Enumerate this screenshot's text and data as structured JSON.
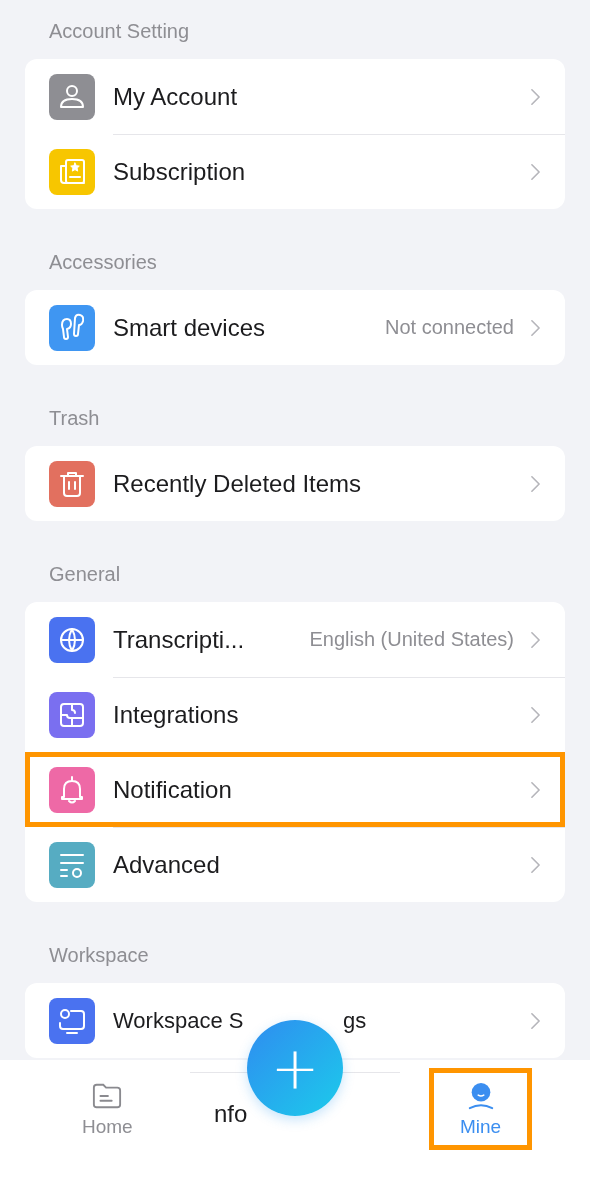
{
  "sections": [
    {
      "title": "Account Setting",
      "rows": [
        {
          "kind": "account",
          "label": "My Account",
          "highlighted": false
        },
        {
          "kind": "subscription",
          "label": "Subscription",
          "highlighted": false
        }
      ]
    },
    {
      "title": "Accessories",
      "rows": [
        {
          "kind": "devices",
          "label": "Smart devices",
          "value": "Not connected",
          "highlighted": false
        }
      ]
    },
    {
      "title": "Trash",
      "rows": [
        {
          "kind": "trash",
          "label": "Recently Deleted Items",
          "highlighted": false
        }
      ]
    },
    {
      "title": "General",
      "rows": [
        {
          "kind": "language",
          "label": "Transcripti...",
          "value": "English (United States)",
          "highlighted": false
        },
        {
          "kind": "integrations",
          "label": "Integrations",
          "highlighted": false
        },
        {
          "kind": "notification",
          "label": "Notification",
          "highlighted": true
        },
        {
          "kind": "advanced",
          "label": "Advanced",
          "highlighted": false
        }
      ]
    },
    {
      "title": "Workspace",
      "rows": [
        {
          "kind": "workspace",
          "label": "Workspace S",
          "label_end": "gs",
          "highlighted": false
        }
      ]
    }
  ],
  "tab_bar": {
    "tabs": [
      {
        "kind": "home",
        "label": "Home",
        "selected": false,
        "highlighted": false
      },
      {
        "kind": "mine",
        "label": "Mine",
        "selected": true,
        "highlighted": true
      }
    ],
    "hidden_label": "nfo",
    "add_button": {
      "label": "+"
    }
  }
}
